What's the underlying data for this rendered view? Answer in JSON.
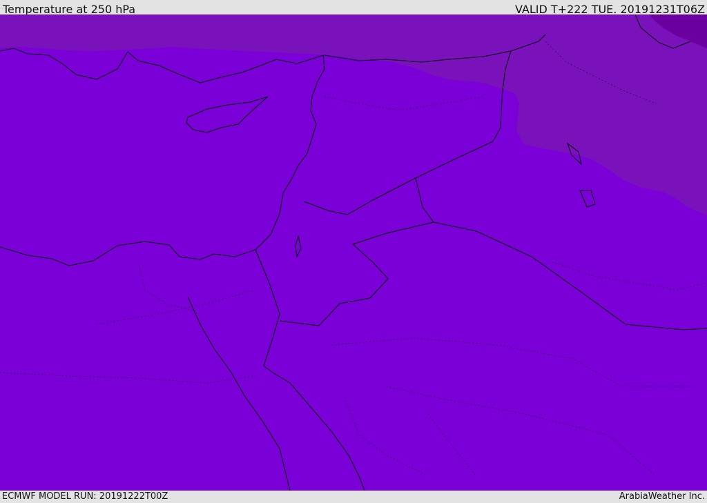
{
  "header": {
    "title": "Temperature at 250 hPa",
    "valid": "VALID T+222 TUE. 20191231T06Z"
  },
  "footer": {
    "model_run": "ECMWF MODEL RUN: 20191222T00Z",
    "credit": "ArabiaWeather Inc."
  },
  "colors": {
    "field_main": "#7b00d8",
    "field_cold": "#7a12bc",
    "field_coldest": "#6a00a0",
    "coastline": "#000000"
  }
}
